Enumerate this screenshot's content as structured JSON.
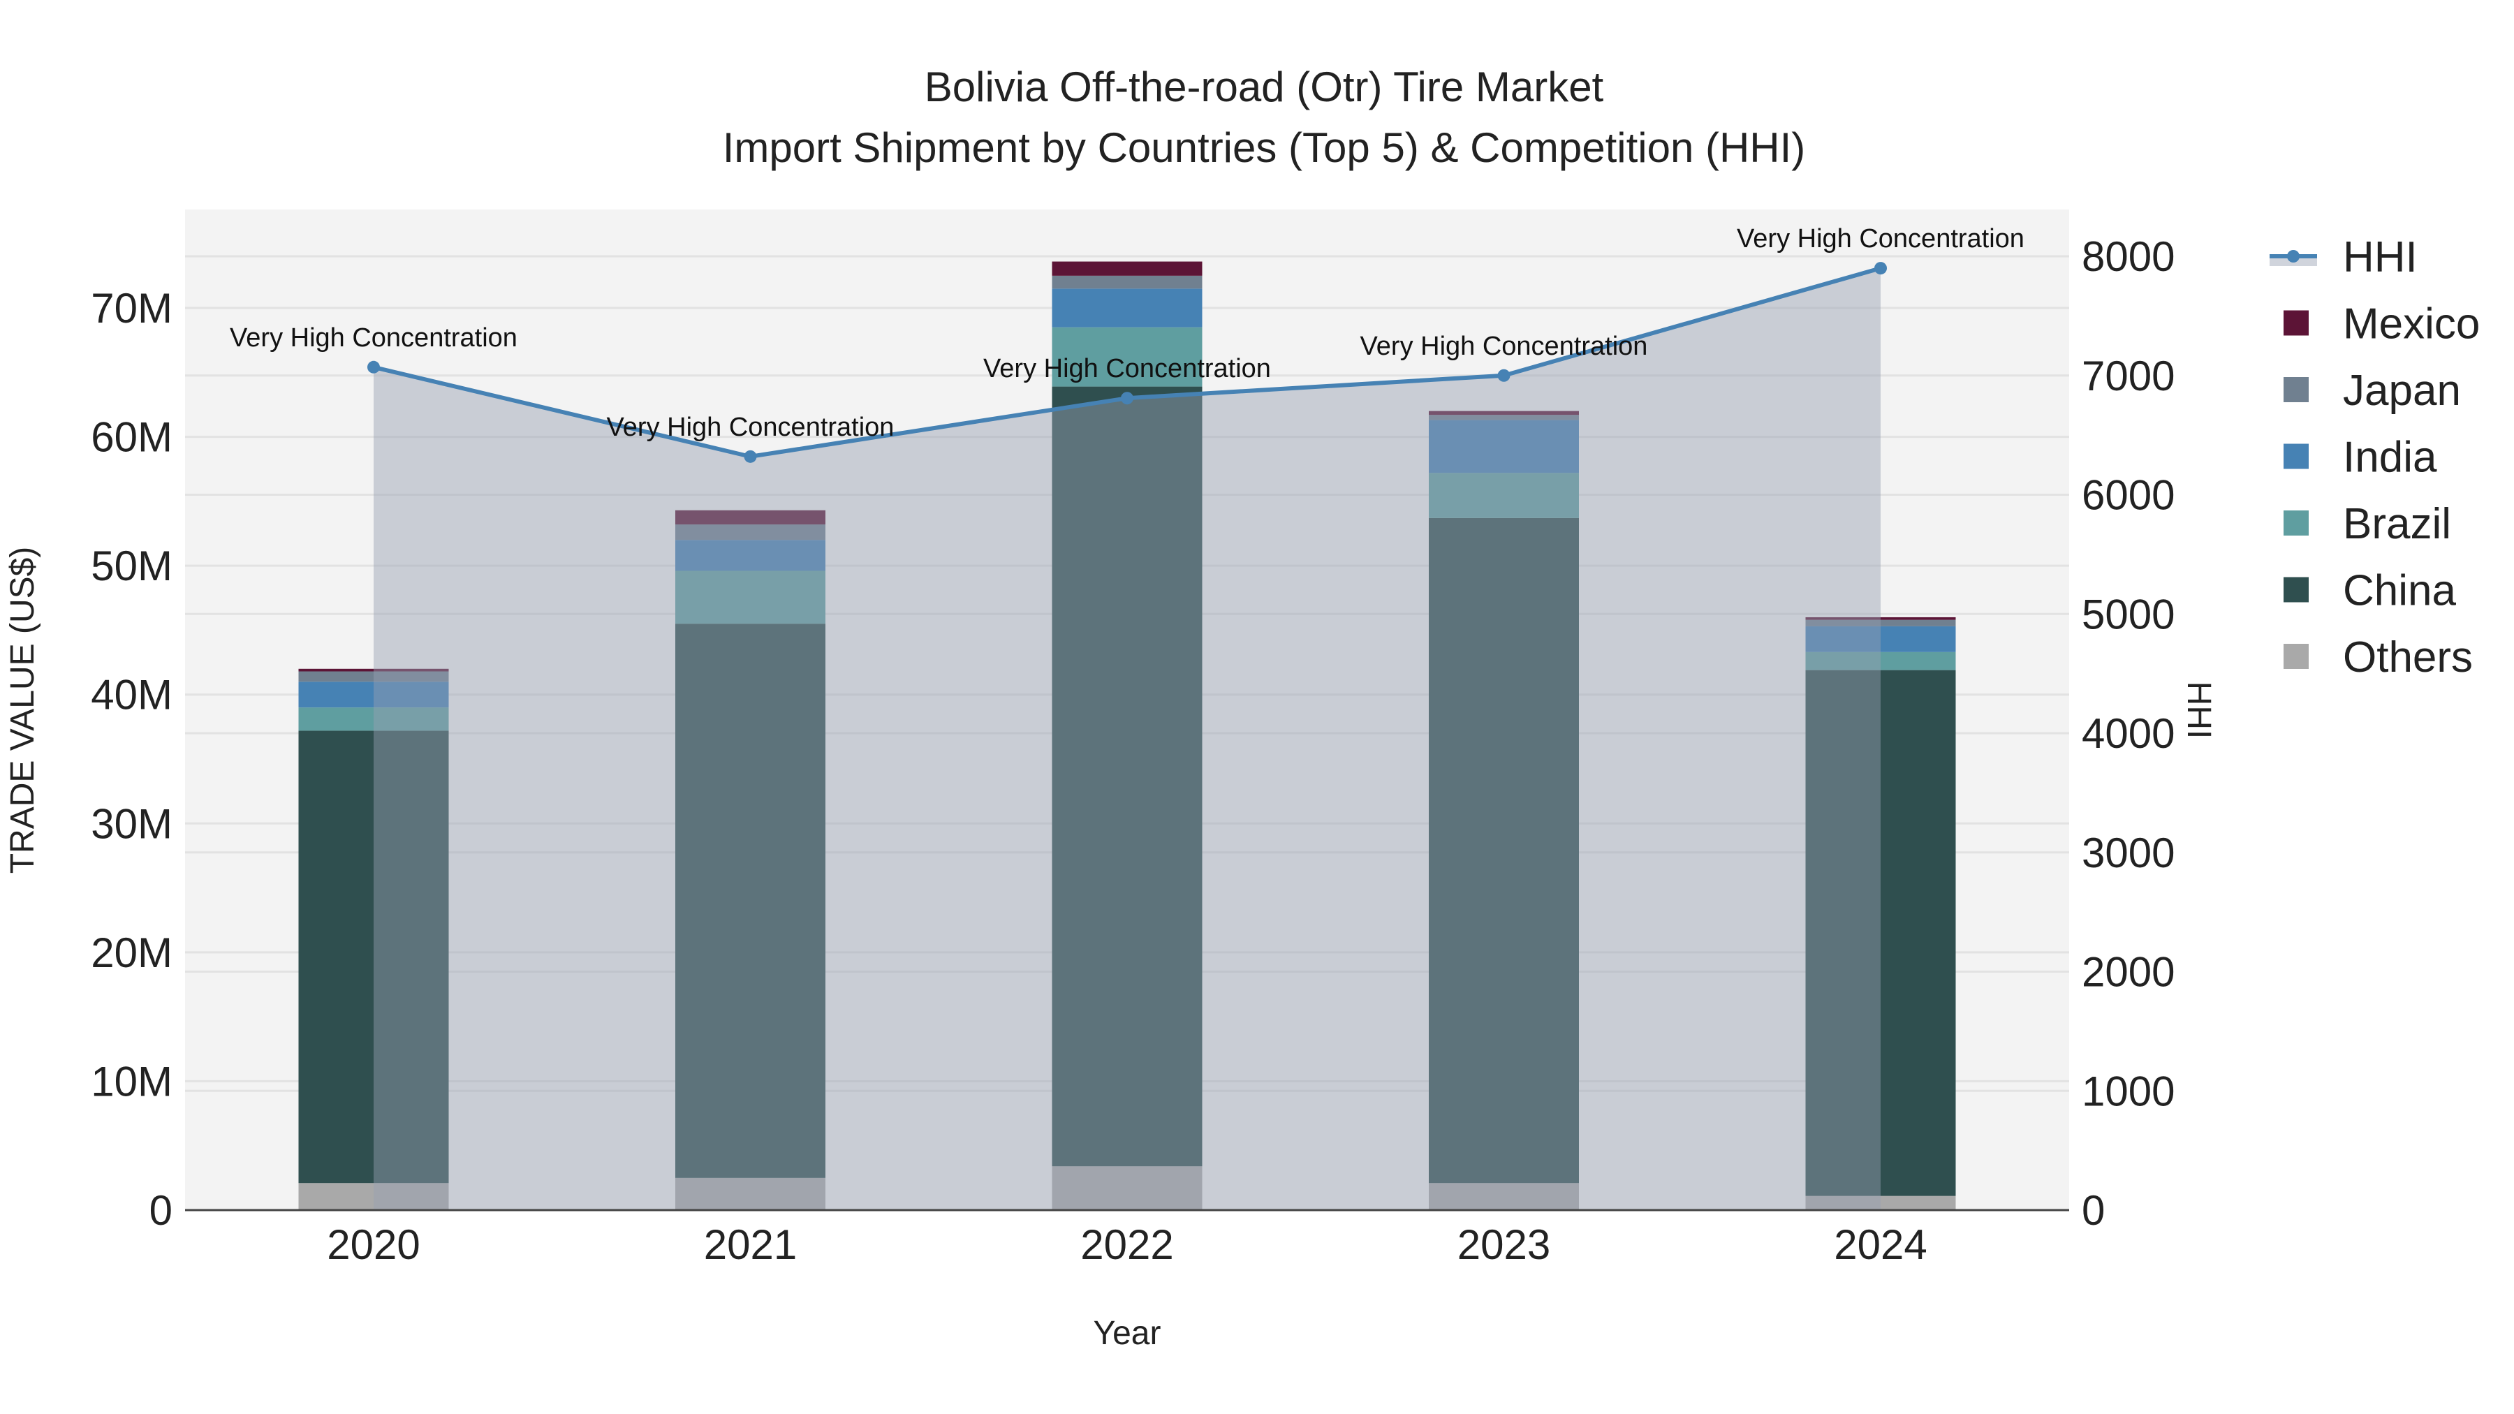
{
  "chart_data": {
    "type": "bar",
    "stacked": true,
    "title": "Bolivia Off-the-road (Otr) Tire Market",
    "subtitle": "Import Shipment by Countries (Top 5) & Competition (HHI)",
    "xlabel": "Year",
    "ylabel": "TRADE VALUE (US$)",
    "y2label": "HHI",
    "categories": [
      "2020",
      "2021",
      "2022",
      "2023",
      "2024"
    ],
    "ylim": [
      0,
      77.5
    ],
    "y_ticks": [
      0,
      10,
      20,
      30,
      40,
      50,
      60,
      70
    ],
    "y_tick_labels": [
      "0",
      "10M",
      "20M",
      "30M",
      "40M",
      "50M",
      "60M",
      "70M"
    ],
    "y2lim": [
      0,
      8400
    ],
    "y2_ticks": [
      0,
      1000,
      2000,
      3000,
      4000,
      5000,
      6000,
      7000,
      8000
    ],
    "y2_tick_labels": [
      "0",
      "1000",
      "2000",
      "3000",
      "4000",
      "5000",
      "6000",
      "7000",
      "8000"
    ],
    "value_unit": "million US$",
    "series": [
      {
        "name": "Others",
        "color": "#a9a9a9",
        "values": [
          2.1,
          2.5,
          3.4,
          2.1,
          1.1
        ]
      },
      {
        "name": "China",
        "color": "#2f4f4f",
        "values": [
          35.1,
          43.0,
          60.5,
          51.6,
          40.8
        ]
      },
      {
        "name": "Brazil",
        "color": "#5f9ea0",
        "values": [
          1.8,
          4.1,
          4.6,
          3.5,
          1.4
        ]
      },
      {
        "name": "India",
        "color": "#4682b4",
        "values": [
          2.0,
          2.4,
          3.0,
          4.1,
          2.0
        ]
      },
      {
        "name": "Japan",
        "color": "#708090",
        "values": [
          0.8,
          1.2,
          1.0,
          0.4,
          0.5
        ]
      },
      {
        "name": "Mexico",
        "color": "#5c1436",
        "values": [
          0.2,
          1.1,
          1.1,
          0.3,
          0.2
        ]
      }
    ],
    "hhi": {
      "name": "HHI",
      "color": "#4682b4",
      "values": [
        7070,
        6320,
        6810,
        7000,
        7900
      ]
    },
    "annotations": [
      "Very High Concentration",
      "Very High Concentration",
      "Very High Concentration",
      "Very High Concentration",
      "Very High Concentration"
    ],
    "legend": [
      "HHI",
      "Mexico",
      "Japan",
      "India",
      "Brazil",
      "China",
      "Others"
    ],
    "legend_position": "right",
    "grid": true
  }
}
